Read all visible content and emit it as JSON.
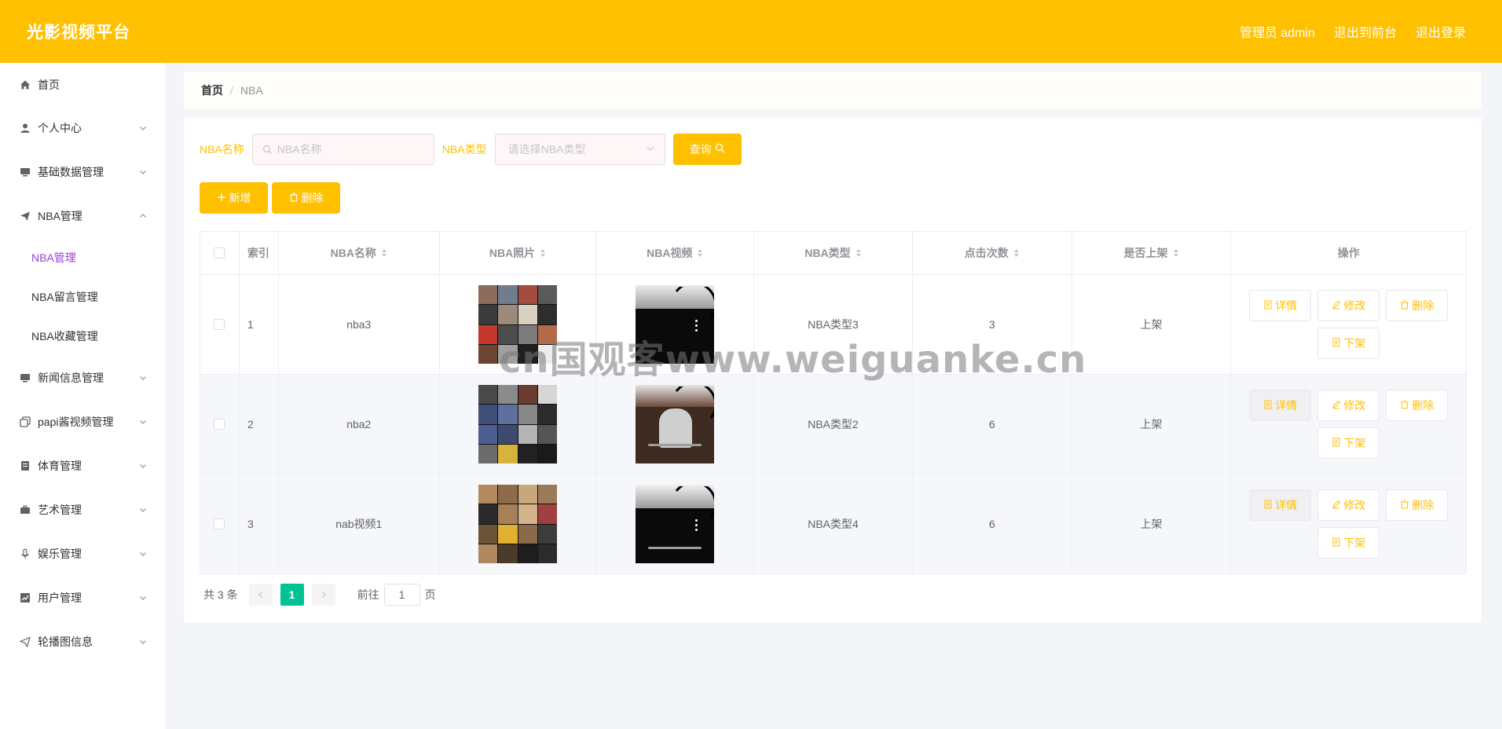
{
  "header": {
    "brand": "光影视频平台",
    "admin": "管理员 admin",
    "to_front": "退出到前台",
    "logout": "退出登录"
  },
  "sidebar": {
    "items": [
      {
        "label": "首页",
        "icon": "home-icon"
      },
      {
        "label": "个人中心",
        "icon": "user-icon"
      },
      {
        "label": "基础数据管理",
        "icon": "monitor-icon"
      },
      {
        "label": "NBA管理",
        "icon": "paper-plane-icon",
        "expanded": true
      },
      {
        "label": "新闻信息管理",
        "icon": "monitor-icon"
      },
      {
        "label": "papi酱视频管理",
        "icon": "copy-icon"
      },
      {
        "label": "体育管理",
        "icon": "document-icon"
      },
      {
        "label": "艺术管理",
        "icon": "suitcase-icon"
      },
      {
        "label": "娱乐管理",
        "icon": "microphone-icon"
      },
      {
        "label": "用户管理",
        "icon": "chart-icon"
      },
      {
        "label": "轮播图信息",
        "icon": "send-icon"
      }
    ],
    "submenu": [
      "NBA管理",
      "NBA留言管理",
      "NBA收藏管理"
    ],
    "active_color": "#9b3fd9"
  },
  "breadcrumb": {
    "home": "首页",
    "sep": "/",
    "current": "NBA"
  },
  "search": {
    "name_label": "NBA名称",
    "name_placeholder": "NBA名称",
    "type_label": "NBA类型",
    "type_placeholder": "请选择NBA类型",
    "query_label": "查询"
  },
  "actions": {
    "add": "新增",
    "delete": "删除"
  },
  "table": {
    "headers": [
      "索引",
      "NBA名称",
      "NBA照片",
      "NBA视频",
      "NBA类型",
      "点击次数",
      "是否上架",
      "操作"
    ],
    "rows": [
      {
        "index": "1",
        "name": "nba3",
        "type": "NBA类型3",
        "clicks": "3",
        "shelf": "上架"
      },
      {
        "index": "2",
        "name": "nba2",
        "type": "NBA类型2",
        "clicks": "6",
        "shelf": "上架"
      },
      {
        "index": "3",
        "name": "nab视频1",
        "type": "NBA类型4",
        "clicks": "6",
        "shelf": "上架"
      }
    ],
    "ops": {
      "detail": "详情",
      "edit": "修改",
      "delete": "删除",
      "off": "下架"
    }
  },
  "pagination": {
    "total": "共 3 条",
    "current": "1",
    "goto": "前往",
    "goto_value": "1",
    "page_unit": "页"
  },
  "watermark": "cn国观客www.weiguanke.cn",
  "colors": {
    "brand": "#ffc000",
    "page_active": "#00c292"
  }
}
